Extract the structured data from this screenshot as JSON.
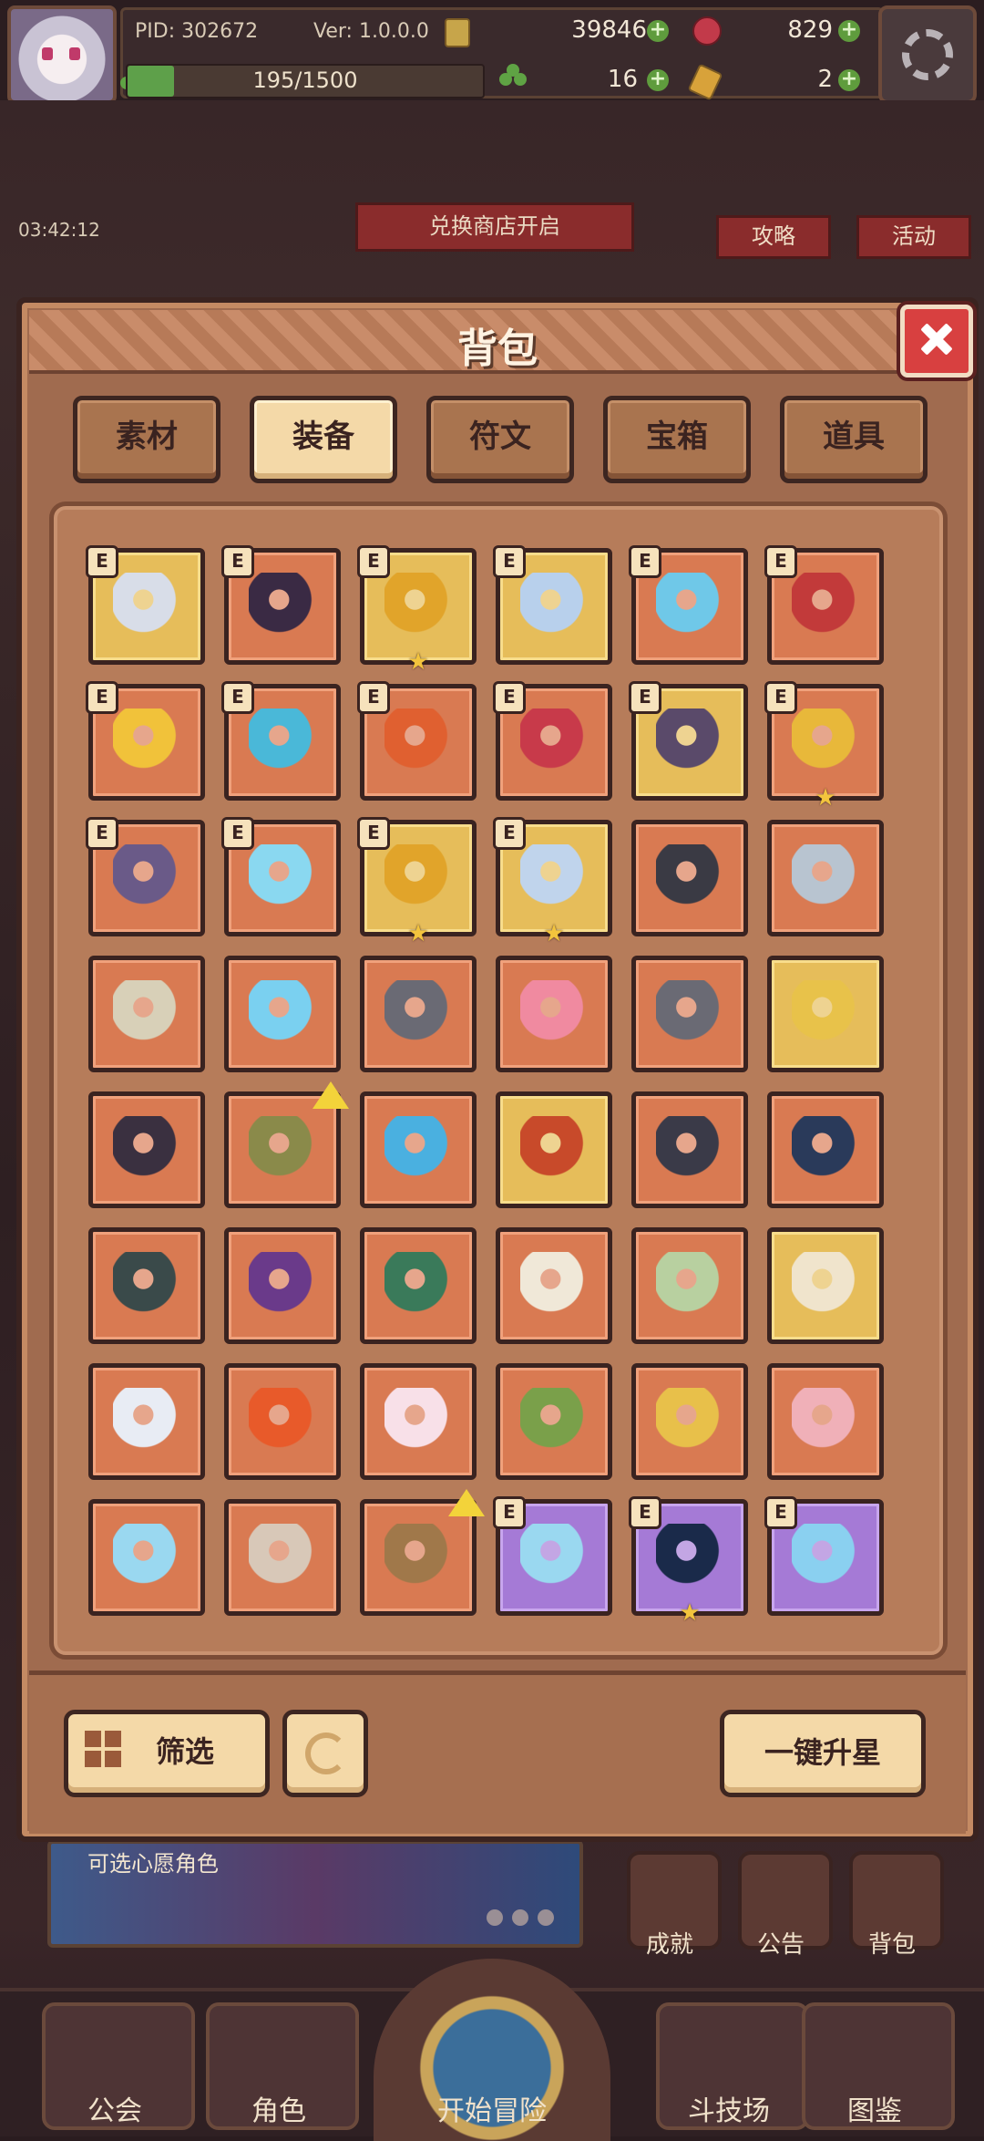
{
  "hud": {
    "pid": "PID: 302672",
    "version": "Ver: 1.0.0.0",
    "gold": "39846",
    "gems": "829",
    "clovers": "16",
    "keys": "2",
    "stamina": "195/1500",
    "stamina_fraction": 0.13
  },
  "scene": {
    "timer": "03:42:12",
    "exchange_shop": "兑换商店开启",
    "guide": "攻略",
    "events": "活动"
  },
  "panel": {
    "title": "背包",
    "tabs": [
      {
        "label": "素材",
        "active": false
      },
      {
        "label": "装备",
        "active": true
      },
      {
        "label": "符文",
        "active": false
      },
      {
        "label": "宝箱",
        "active": false
      },
      {
        "label": "道具",
        "active": false
      }
    ],
    "equipped_badge": "E",
    "items": [
      {
        "name": "silver-staff",
        "bg": "gold",
        "equipped": true,
        "star": false,
        "upgrade": false,
        "color": "#d8dde8"
      },
      {
        "name": "dark-scepter",
        "bg": "orange",
        "equipped": true,
        "star": false,
        "upgrade": false,
        "color": "#3a2a44"
      },
      {
        "name": "gold-ring",
        "bg": "gold",
        "equipped": true,
        "star": true,
        "upgrade": false,
        "color": "#e1a42a"
      },
      {
        "name": "crystal-crown",
        "bg": "gold",
        "equipped": true,
        "star": false,
        "upgrade": false,
        "color": "#b8d0ec"
      },
      {
        "name": "ice-armor",
        "bg": "orange",
        "equipped": true,
        "star": false,
        "upgrade": false,
        "color": "#6fc8e8"
      },
      {
        "name": "royal-robe",
        "bg": "orange",
        "equipped": true,
        "star": false,
        "upgrade": false,
        "color": "#c23a3a"
      },
      {
        "name": "gold-chestplate",
        "bg": "orange",
        "equipped": true,
        "star": false,
        "upgrade": false,
        "color": "#f1c23a"
      },
      {
        "name": "frost-boots",
        "bg": "orange",
        "equipped": true,
        "star": false,
        "upgrade": false,
        "color": "#4ab8d8"
      },
      {
        "name": "flame-gauntlet",
        "bg": "orange",
        "equipped": true,
        "star": false,
        "upgrade": false,
        "color": "#e06030"
      },
      {
        "name": "ruby-belt",
        "bg": "orange",
        "equipped": true,
        "star": false,
        "upgrade": false,
        "color": "#c83a4a"
      },
      {
        "name": "shadow-pauldron",
        "bg": "gold",
        "equipped": true,
        "star": false,
        "upgrade": false,
        "color": "#5a4a6a"
      },
      {
        "name": "gold-greaves",
        "bg": "orange",
        "equipped": true,
        "star": true,
        "upgrade": false,
        "color": "#e8b83a"
      },
      {
        "name": "void-boots",
        "bg": "orange",
        "equipped": true,
        "star": false,
        "upgrade": false,
        "color": "#6a5a88"
      },
      {
        "name": "frost-gem",
        "bg": "orange",
        "equipped": true,
        "star": false,
        "upgrade": false,
        "color": "#8ad8f0"
      },
      {
        "name": "heart-necklace",
        "bg": "gold",
        "equipped": true,
        "star": true,
        "upgrade": false,
        "color": "#e1a42a"
      },
      {
        "name": "silver-helm",
        "bg": "gold",
        "equipped": true,
        "star": true,
        "upgrade": false,
        "color": "#c0d4ec"
      },
      {
        "name": "dark-scythe",
        "bg": "orange",
        "equipped": false,
        "star": false,
        "upgrade": false,
        "color": "#3a3a44"
      },
      {
        "name": "crossed-swords",
        "bg": "orange",
        "equipped": false,
        "star": false,
        "upgrade": false,
        "color": "#b8c4d0"
      },
      {
        "name": "battle-axe",
        "bg": "orange",
        "equipped": false,
        "star": false,
        "upgrade": false,
        "color": "#d8d0b8"
      },
      {
        "name": "azure-sword",
        "bg": "orange",
        "equipped": false,
        "star": false,
        "upgrade": false,
        "color": "#7ad0f0"
      },
      {
        "name": "short-dagger",
        "bg": "orange",
        "equipped": false,
        "star": false,
        "upgrade": false,
        "color": "#6a6a74"
      },
      {
        "name": "pink-mask",
        "bg": "orange",
        "equipped": false,
        "star": false,
        "upgrade": false,
        "color": "#f08aa0"
      },
      {
        "name": "iron-hood",
        "bg": "orange",
        "equipped": false,
        "star": false,
        "upgrade": false,
        "color": "#6a6a74"
      },
      {
        "name": "gold-amulet",
        "bg": "gold",
        "equipped": false,
        "star": false,
        "upgrade": false,
        "color": "#e8c24a"
      },
      {
        "name": "horned-helm",
        "bg": "orange",
        "equipped": false,
        "star": false,
        "upgrade": false,
        "color": "#3a3040"
      },
      {
        "name": "bronze-helm",
        "bg": "orange",
        "equipped": false,
        "star": false,
        "upgrade": true,
        "color": "#8a8a4a"
      },
      {
        "name": "blue-hat",
        "bg": "orange",
        "equipped": false,
        "star": false,
        "upgrade": false,
        "color": "#4ab0e0"
      },
      {
        "name": "flame-crest",
        "bg": "gold",
        "equipped": false,
        "star": false,
        "upgrade": false,
        "color": "#c84a2a"
      },
      {
        "name": "shadow-glove",
        "bg": "orange",
        "equipped": false,
        "star": false,
        "upgrade": false,
        "color": "#3a3a48"
      },
      {
        "name": "rose-gauntlet",
        "bg": "orange",
        "equipped": false,
        "star": false,
        "upgrade": false,
        "color": "#2a3a5a"
      },
      {
        "name": "dragon-helm",
        "bg": "orange",
        "equipped": false,
        "star": false,
        "upgrade": false,
        "color": "#3a4a4a"
      },
      {
        "name": "amethyst-ring",
        "bg": "orange",
        "equipped": false,
        "star": false,
        "upgrade": false,
        "color": "#6a3a8a"
      },
      {
        "name": "jade-boots",
        "bg": "orange",
        "equipped": false,
        "star": false,
        "upgrade": false,
        "color": "#3a7a5a"
      },
      {
        "name": "winged-boots",
        "bg": "orange",
        "equipped": false,
        "star": false,
        "upgrade": false,
        "color": "#f0e8d8"
      },
      {
        "name": "moss-boots",
        "bg": "orange",
        "equipped": false,
        "star": false,
        "upgrade": false,
        "color": "#b8d0a0"
      },
      {
        "name": "cloth-boots",
        "bg": "gold",
        "equipped": false,
        "star": false,
        "upgrade": false,
        "color": "#f0e4cc"
      },
      {
        "name": "steel-boots",
        "bg": "orange",
        "equipped": false,
        "star": false,
        "upgrade": false,
        "color": "#e8ecf4"
      },
      {
        "name": "fire-gem",
        "bg": "orange",
        "equipped": false,
        "star": false,
        "upgrade": false,
        "color": "#e85a2a"
      },
      {
        "name": "pearl-charm",
        "bg": "orange",
        "equipped": false,
        "star": false,
        "upgrade": false,
        "color": "#f8e0e8"
      },
      {
        "name": "leaf-pendant",
        "bg": "orange",
        "equipped": false,
        "star": false,
        "upgrade": false,
        "color": "#7aa04a"
      },
      {
        "name": "gold-shield",
        "bg": "orange",
        "equipped": false,
        "star": false,
        "upgrade": false,
        "color": "#e8c04a"
      },
      {
        "name": "heart-choker",
        "bg": "orange",
        "equipped": false,
        "star": false,
        "upgrade": false,
        "color": "#f0b0b8"
      },
      {
        "name": "ice-collar",
        "bg": "orange",
        "equipped": false,
        "star": false,
        "upgrade": false,
        "color": "#9ad8f0"
      },
      {
        "name": "bone-necklace",
        "bg": "orange",
        "equipped": false,
        "star": false,
        "upgrade": false,
        "color": "#d8c8b8"
      },
      {
        "name": "seed-pot",
        "bg": "orange",
        "equipped": false,
        "star": false,
        "upgrade": true,
        "color": "#a0784a"
      },
      {
        "name": "crystal-blade",
        "bg": "purple",
        "equipped": true,
        "star": false,
        "upgrade": false,
        "color": "#9ad8f0"
      },
      {
        "name": "void-orb",
        "bg": "purple",
        "equipped": true,
        "star": true,
        "upgrade": false,
        "color": "#1a2a4a"
      },
      {
        "name": "ice-scroll",
        "bg": "purple",
        "equipped": true,
        "star": false,
        "upgrade": false,
        "color": "#8ad0f0"
      }
    ]
  },
  "toolbar": {
    "filter_label": "筛选",
    "star_up_label": "一键升星"
  },
  "below": {
    "wish": "可选心愿角色",
    "achievements": "成就",
    "notice": "公告",
    "bag": "背包"
  },
  "nav": {
    "guild": "公会",
    "characters": "角色",
    "adventure": "开始冒险",
    "arena": "斗技场",
    "codex": "图鉴"
  },
  "colors": {
    "panel": "#a06b4f",
    "cell_orange": "#d97a52",
    "cell_gold": "#e6bd5a",
    "cell_purple": "#a57ad6",
    "accent_green": "#5ea04a",
    "close_red": "#d84040"
  }
}
